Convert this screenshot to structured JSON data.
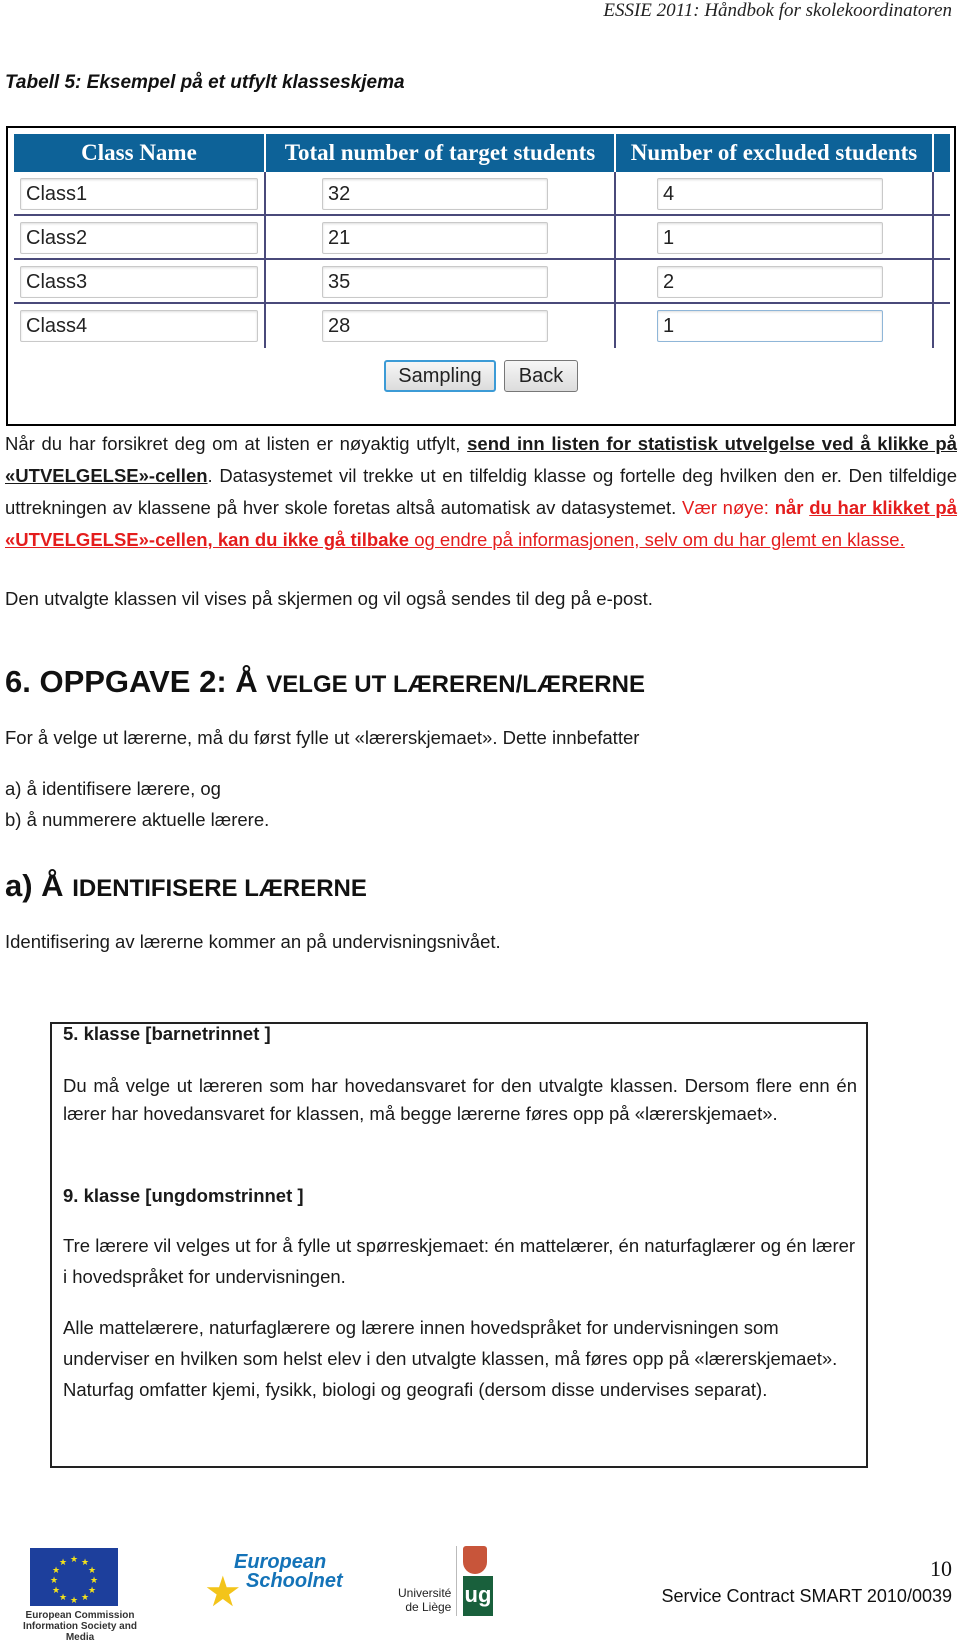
{
  "header": {
    "running_title": "ESSIE 2011: Håndbok for skolekoordinatoren"
  },
  "caption": "Tabell 5: Eksempel på et utfylt klasseskjema",
  "form": {
    "columns": [
      "Class Name",
      "Total number of target students",
      "Number of excluded students"
    ],
    "rows": [
      {
        "class_name": "Class1",
        "total": "32",
        "excluded": "4"
      },
      {
        "class_name": "Class2",
        "total": "21",
        "excluded": "1"
      },
      {
        "class_name": "Class3",
        "total": "35",
        "excluded": "2"
      },
      {
        "class_name": "Class4",
        "total": "28",
        "excluded": "1"
      }
    ],
    "sampling_label": "Sampling",
    "back_label": "Back"
  },
  "para1": {
    "a": "Når du har forsikret deg om at listen er nøyaktig utfylt, ",
    "b": "send inn listen for statistisk utvelgelse ved å klikke på «UTVELGELSE»-cellen",
    "c": ". Datasystemet vil trekke ut en tilfeldig klasse og fortelle deg hvilken den er. Den tilfeldige uttrekningen av klassene på hver skole foretas altså automatisk av datasystemet. ",
    "d": "Vær nøye: ",
    "e": "når ",
    "f": "du har klikket på «UTVELGELSE»-cellen, kan du ikke gå tilbake",
    "g": " og endre på informasjonen, selv om du har glemt en klasse."
  },
  "para2": "Den utvalgte klassen vil vises på skjermen og vil også sendes til deg på e-post.",
  "section6": {
    "prefix": "6. OPPGAVE 2: Å ",
    "rest": "VELGE UT LÆREREN/LÆRERNE"
  },
  "para3": "For å velge ut lærerne, må du først fylle ut «lærerskjemaet». Dette innbefatter",
  "list": [
    "a) å identifisere lærere, og",
    "b) å nummerere aktuelle lærere."
  ],
  "section_a": {
    "prefix": "a) Å ",
    "rest": "IDENTIFISERE LÆRERNE"
  },
  "para4": "Identifisering av lærerne kommer an på undervisningsnivået.",
  "box": {
    "grade5_title": "5. klasse [barnetrinnet ]",
    "grade5_text": "Du må velge ut læreren som har hovedansvaret for den utvalgte klassen. Dersom flere enn én lærer har hovedansvaret for klassen, må begge lærerne føres opp på «lærerskjemaet».",
    "grade9_title": "9. klasse [ungdomstrinnet ]",
    "grade9_text1": "Tre lærere vil velges ut for å fylle ut spørreskjemaet: én mattelærer, én naturfaglærer og én lærer i hovedspråket for undervisningen.",
    "grade9_text2": "Alle mattelærere, naturfaglærere og lærere innen hovedspråket for undervisningen som underviser en hvilken som helst elev i den utvalgte klassen, må føres opp på «lærerskjemaet». Naturfag omfatter kjemi, fysikk, biologi og geografi (dersom disse undervises separat)."
  },
  "footer": {
    "ec_line1": "European Commission",
    "ec_line2": "Information Society and Media",
    "esn_line1": "European",
    "esn_line2": "Schoolnet",
    "ulg_line1": "Université",
    "ulg_line2": "de Liège",
    "ulg_mark": "ug",
    "page_number": "10",
    "contract": "Service Contract SMART 2010/0039"
  },
  "colors": {
    "table_header": "#0d6298",
    "warning_red": "#e41d1d",
    "ulg_green": "#19603c",
    "eu_blue": "#1d3f9c"
  }
}
